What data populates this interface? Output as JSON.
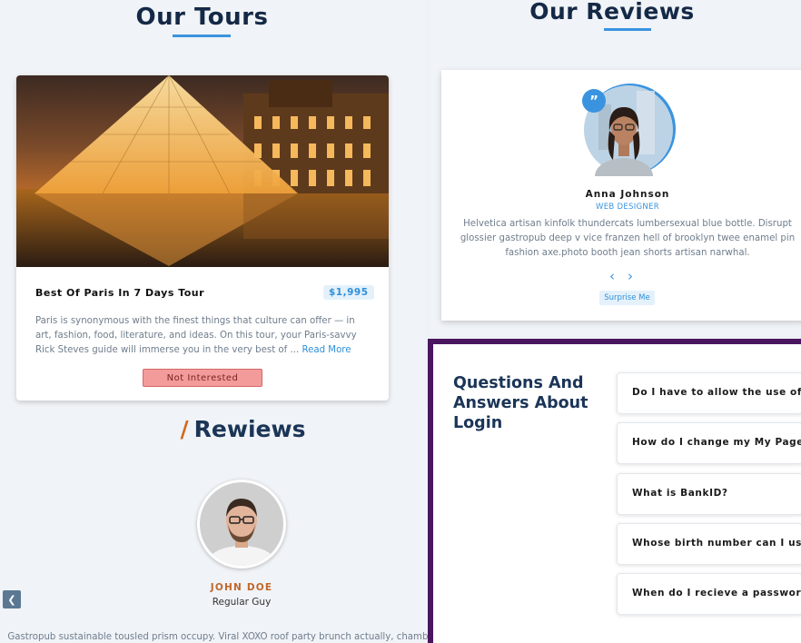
{
  "tours": {
    "title": "Our Tours",
    "card": {
      "name": "Best Of Paris In 7 Days Tour",
      "price": "$1,995",
      "description": "Paris is synonymous with the finest things that culture can offer — in art, fashion, food, literature, and ideas. On this tour, your Paris-savvy Rick Steves guide will immerse you in the very best of ...",
      "read_more": "Read More",
      "not_interested": "Not Interested"
    }
  },
  "rewiews": {
    "slash": "/",
    "title": "Rewiews",
    "name": "JOHN DOE",
    "role": "Regular Guy",
    "text": "Gastropub sustainable tousled prism occupy. Viral XOXO roof party brunch actually, chambray listicle",
    "prev_icon": "chevron-left-icon",
    "next_icon": "chevron-right-icon"
  },
  "reviews": {
    "title": "Our Reviews",
    "name": "Anna Johnson",
    "role": "WEB DESIGNER",
    "text": "Helvetica artisan kinfolk thundercats lumbersexual blue bottle. Disrupt glossier gastropub deep v vice franzen hell of brooklyn twee enamel pin fashion axe.photo booth jean shorts artisan narwhal.",
    "surprise": "Surprise Me",
    "quote_icon": "quote-icon"
  },
  "faq": {
    "heading": "Questions And Answers About Login",
    "items": [
      "Do I have to allow the use of cookies?",
      "How do I change my My Page password?",
      "What is BankID?",
      "Whose birth number can I use?",
      "When do I recieve a password ordered by letter?"
    ]
  },
  "colors": {
    "accent": "#3a93df",
    "heading": "#142946",
    "faq_border": "#4a1660",
    "danger_button": "#f39b9b",
    "name_orange": "#c0672b"
  }
}
